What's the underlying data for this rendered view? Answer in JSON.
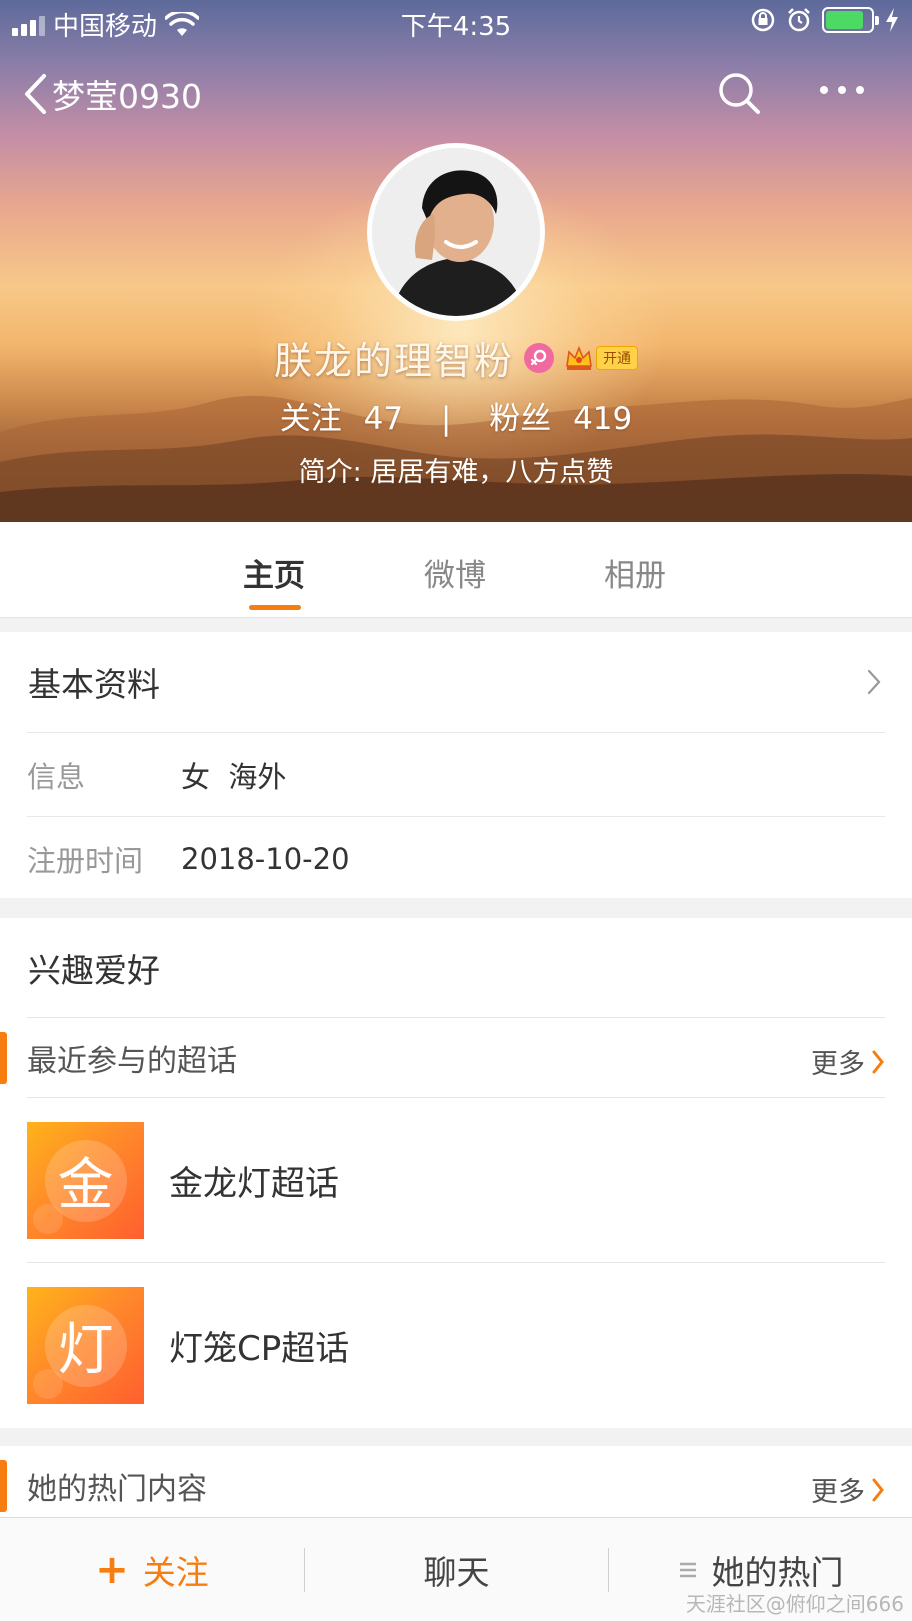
{
  "status_bar": {
    "carrier": "中国移动",
    "time": "下午4:35"
  },
  "nav": {
    "back_title": "梦莹0930",
    "search_icon": "search-icon",
    "more_icon": "more-dots-icon"
  },
  "profile": {
    "name": "朕龙的理智粉",
    "vip_label": "开通",
    "follow_label": "关注",
    "follow_count": "47",
    "fans_label": "粉丝",
    "fans_count": "419",
    "bio": "简介: 居居有难，八方点赞"
  },
  "tabs": [
    {
      "label": "主页",
      "active": true
    },
    {
      "label": "微博",
      "active": false
    },
    {
      "label": "相册",
      "active": false
    }
  ],
  "basic_info": {
    "title": "基本资料",
    "rows": [
      {
        "key": "信息",
        "value": "女  海外"
      },
      {
        "key": "注册时间",
        "value": "2018-10-20"
      }
    ]
  },
  "hobbies": {
    "title": "兴趣爱好",
    "section_title": "最近参与的超话",
    "more_label": "更多",
    "topics": [
      {
        "glyph": "金",
        "name": "金龙灯超话"
      },
      {
        "glyph": "灯",
        "name": "灯笼CP超话"
      }
    ]
  },
  "hot": {
    "title": "她的热门内容",
    "more_label": "更多"
  },
  "toolbar": {
    "follow": "关注",
    "chat": "聊天",
    "hot": "她的热门"
  },
  "watermark": "天涯社区@俯仰之间666",
  "colors": {
    "accent": "#f77d11",
    "female_badge": "#f06aa0",
    "battery": "#4cd964"
  }
}
